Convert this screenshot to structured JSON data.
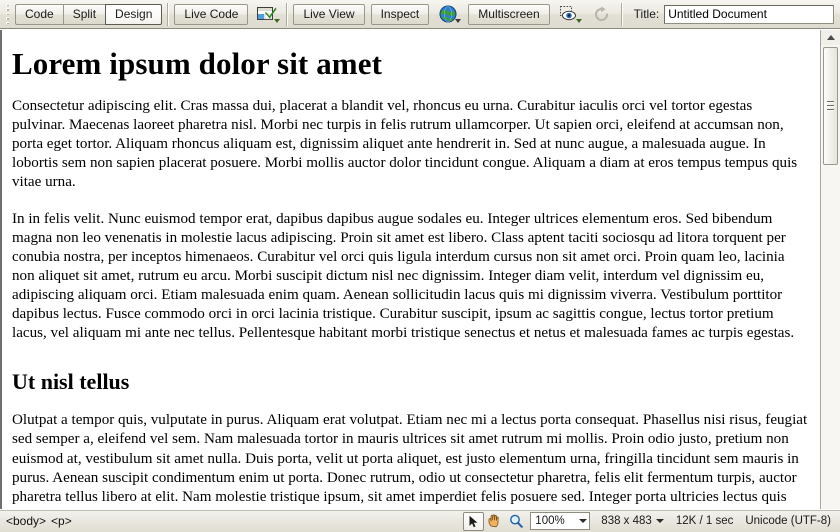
{
  "toolbar": {
    "view_modes": [
      {
        "label": "Code",
        "active": false
      },
      {
        "label": "Split",
        "active": false
      },
      {
        "label": "Design",
        "active": true
      }
    ],
    "live_code_label": "Live Code",
    "inspect_settings_icon": "browser-check-icon",
    "live_view_label": "Live View",
    "inspect_label": "Inspect",
    "globe_icon": "globe-icon",
    "multiscreen_label": "Multiscreen",
    "visual_aids_icon": "eye-visual-aids-icon",
    "refresh_icon": "refresh-icon",
    "title_label": "Title:",
    "title_value": "Untitled Document",
    "title_placeholder": "Untitled Document"
  },
  "document": {
    "heading1": "Lorem ipsum dolor sit amet",
    "paragraph1": "Consectetur adipiscing elit. Cras massa dui, placerat a blandit vel, rhoncus eu urna. Curabitur iaculis orci vel tortor egestas pulvinar. Maecenas laoreet pharetra nisl. Morbi nec turpis in felis rutrum ullamcorper. Ut sapien orci, eleifend at accumsan non, porta eget tortor. Aliquam rhoncus aliquam est, dignissim aliquet ante hendrerit in. Sed at nunc augue, a malesuada augue. In lobortis sem non sapien placerat posuere. Morbi mollis auctor dolor tincidunt congue. Aliquam a diam at eros tempus tempus quis vitae urna.",
    "paragraph2": "In in felis velit. Nunc euismod tempor erat, dapibus dapibus augue sodales eu. Integer ultrices elementum eros. Sed bibendum magna non leo venenatis in molestie lacus adipiscing. Proin sit amet est libero. Class aptent taciti sociosqu ad litora torquent per conubia nostra, per inceptos himenaeos. Curabitur vel orci quis ligula interdum cursus non sit amet orci. Proin quam leo, lacinia non aliquet sit amet, rutrum eu arcu. Morbi suscipit dictum nisl nec dignissim. Integer diam velit, interdum vel dignissim eu, adipiscing aliquam orci. Etiam malesuada enim quam. Aenean sollicitudin lacus quis mi dignissim viverra. Vestibulum porttitor dapibus lectus. Fusce commodo orci in orci lacinia tristique. Curabitur suscipit, ipsum ac sagittis congue, lectus tortor pretium lacus, vel aliquam mi ante nec tellus. Pellentesque habitant morbi tristique senectus et netus et malesuada fames ac turpis egestas.",
    "heading2": "Ut nisl tellus",
    "paragraph3": "Olutpat a tempor quis, vulputate in purus. Aliquam erat volutpat. Etiam nec mi a lectus porta consequat. Phasellus nisi risus, feugiat sed semper a, eleifend vel sem. Nam malesuada tortor in mauris ultrices sit amet rutrum mi mollis. Proin odio justo, pretium non euismod at, vestibulum sit amet nulla. Duis porta, velit ut porta aliquet, est justo elementum urna, fringilla tincidunt sem mauris in purus. Aenean suscipit condimentum enim ut porta. Donec rutrum, odio ut consectetur pharetra, felis elit fermentum turpis, auctor pharetra tellus libero at elit. Nam molestie tristique ipsum, sit amet imperdiet felis posuere sed. Integer porta ultricies lectus quis ullamcorper. Sed sit amet mi quis turpis rhoncus posuere."
  },
  "statusbar": {
    "tag_selector": [
      "<body>",
      "<p>"
    ],
    "tools": [
      {
        "icon": "select-arrow-icon",
        "selected": true
      },
      {
        "icon": "hand-pan-icon",
        "selected": false
      },
      {
        "icon": "zoom-magnifier-icon",
        "selected": false
      }
    ],
    "zoom_value": "100%",
    "window_size": "838 x 483",
    "download_size": "12K / 1 sec",
    "encoding": "Unicode (UTF-8)"
  },
  "colors": {
    "chrome": "#ece9d8",
    "page_bg": "#ffffff",
    "text": "#000000",
    "accent_green": "#3c6b1e"
  }
}
